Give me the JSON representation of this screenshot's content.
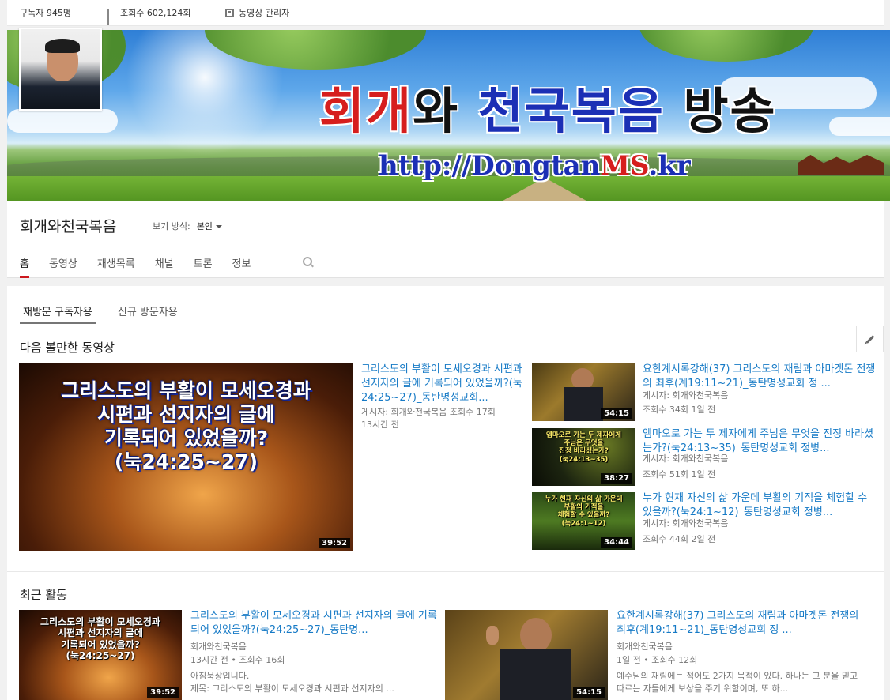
{
  "stats": {
    "subscribers": "구독자 945명",
    "views": "조회수 602,124회",
    "video_manager": "동영상 관리자"
  },
  "banner": {
    "title_parts": [
      "회개",
      "와 ",
      "천국복음",
      " 방송"
    ],
    "url_parts": [
      "http://Dongtan",
      "MS",
      ".kr"
    ]
  },
  "channel": {
    "name": "회개와천국복음",
    "view_as_label": "보기 방식:",
    "view_as_value": "본인"
  },
  "tabs": [
    "홈",
    "동영상",
    "재생목록",
    "채널",
    "토론",
    "정보"
  ],
  "subtabs": [
    "재방문 구독자용",
    "신규 방문자용"
  ],
  "sections": {
    "watch_next": "다음 볼만한 동영상",
    "recent": "최근 활동"
  },
  "featured": {
    "thumb_text": [
      "그리스도의 부활이 모세오경과",
      "시편과 선지자의 글에",
      "기록되어 있었을까?",
      "(눅24:25~27)"
    ],
    "duration": "39:52",
    "title": "그리스도의 부활이 모세오경과 시편과 선지자의 글에 기록되어 있었을까?(눅24:25~27)_동탄명성교회...",
    "meta1": "게시자: 회개와천국복음   조회수 17회",
    "meta2": "13시간 전"
  },
  "side_videos": [
    {
      "title": "요한계시록강해(37) 그리스도의 재림과 아마겟돈 전쟁의 최후(계19:11~21)_동탄명성교회 정 ...",
      "uploader": "게시자: 회개와천국복음",
      "meta": "조회수 34회   1일 전",
      "duration": "54:15",
      "thumb_text": []
    },
    {
      "title": "엠마오로 가는 두 제자에게 주님은 무엇을 진정 바라셨는가?(눅24:13~35)_동탄명성교회 정병...",
      "uploader": "게시자: 회개와천국복음",
      "meta": "조회수 51회   1일 전",
      "duration": "38:27",
      "thumb_text": [
        "엠마오로 가는 두 제자에게",
        "주님은 무엇을",
        "진정 바라셨는가?",
        "(눅24:13~35)"
      ]
    },
    {
      "title": "누가 현재 자신의 삶 가운데 부활의 기적을 체험할 수 있을까?(눅24:1~12)_동탄명성교회 정병...",
      "uploader": "게시자: 회개와천국복음",
      "meta": "조회수 44회   2일 전",
      "duration": "34:44",
      "thumb_text": [
        "누가 현재 자신의 삶 가운데",
        "부활의 기적을",
        "체험할 수 있을까?",
        "(눅24:1~12)"
      ]
    }
  ],
  "recent": [
    {
      "title": "그리스도의 부활이 모세오경과 시편과 선지자의 글에 기록되어 있었을까?(눅24:25~27)_동탄명...",
      "channel": "회개와천국복음",
      "meta": "13시간 전 • 조회수 16회",
      "desc": "아침묵상입니다.\n제목: 그리스도의 부활이 모세오경과 시편과 선지자의 ...",
      "duration": "39:52",
      "thumb_text": [
        "그리스도의 부활이 모세오경과",
        "시편과 선지자의 글에",
        "기록되어 있었을까?",
        "(눅24:25~27)"
      ]
    },
    {
      "title": "요한계시록강해(37) 그리스도의 재림과 아마겟돈 전쟁의 최후(계19:11~21)_동탄명성교회 정 ...",
      "channel": "회개와천국복음",
      "meta": "1일 전 • 조회수 12회",
      "desc": "예수님의 재림에는 적어도 2가지 목적이 있다. 하나는 그 분을 믿고 따르는 자들에게 보상을 주기 위함이며, 또 하...",
      "duration": "54:15",
      "thumb_text": []
    }
  ],
  "colors": {
    "link": "#167ac6",
    "active_tab": "#cc181e"
  }
}
